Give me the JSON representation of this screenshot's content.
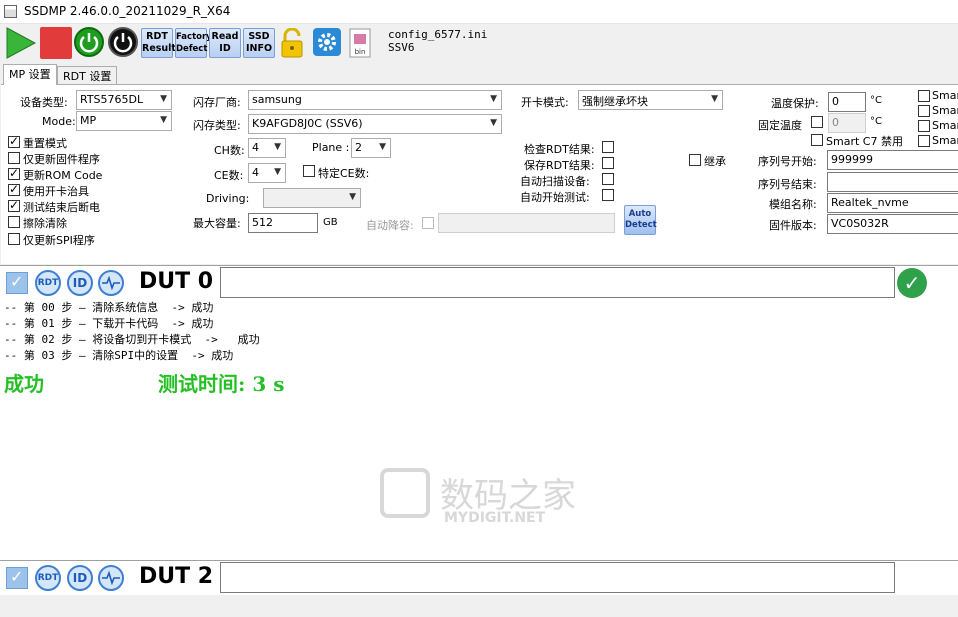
{
  "window": {
    "title": "SSDMP 2.46.0.0_20211029_R_X64"
  },
  "toolbar": {
    "rdt_result": [
      "RDT",
      "Result"
    ],
    "factory_defect": [
      "Factory",
      "Defect"
    ],
    "read_id": [
      "Read",
      "ID"
    ],
    "ssd_info": [
      "SSD",
      "INFO"
    ],
    "bin_label": "bin",
    "config_file": "config_6577.ini",
    "config_name": "SSV6"
  },
  "tabs": [
    "MP 设置",
    "RDT 设置"
  ],
  "mp": {
    "device_type_label": "设备类型:",
    "device_type": "RTS5765DL",
    "mode_label": "Mode:",
    "mode": "MP",
    "options": [
      {
        "label": "重置模式",
        "checked": true
      },
      {
        "label": "仅更新固件程序",
        "checked": false
      },
      {
        "label": "更新ROM Code",
        "checked": true
      },
      {
        "label": "使用开卡治具",
        "checked": true
      },
      {
        "label": "测试结束后断电",
        "checked": true
      },
      {
        "label": "擦除清除",
        "checked": false
      },
      {
        "label": "仅更新SPI程序",
        "checked": false
      }
    ],
    "flash_vendor_label": "闪存厂商:",
    "flash_vendor": "samsung",
    "flash_type_label": "闪存类型:",
    "flash_type": "K9AFGD8J0C (SSV6)",
    "ch_label": "CH数:",
    "ch": "4",
    "plane_label": "Plane :",
    "plane": "2",
    "ce_label": "CE数:",
    "ce": "4",
    "specific_ce_label": "特定CE数:",
    "driving_label": "Driving:",
    "driving": "",
    "max_capacity_label": "最大容量:",
    "max_capacity": "512",
    "gb_unit": "GB",
    "auto_downgrade_label": "自动降容:",
    "card_mode_label": "开卡模式:",
    "card_mode": "强制继承坏块",
    "check_rdt_label": "检查RDT结果:",
    "save_rdt_label": "保存RDT结果:",
    "auto_scan_label": "自动扫描设备:",
    "auto_start_label": "自动开始测试:",
    "inherit_label": "继承",
    "auto_detect": [
      "Auto",
      "Detect"
    ],
    "temp_protect_label": "温度保护:",
    "temp_protect": "0",
    "fixed_temp_label": "固定温度",
    "fixed_temp": "0",
    "temp_unit": "°C",
    "smart_c7_label": "Smart C7 禁用",
    "smart_labels": [
      "Smar",
      "Smar",
      "Smar",
      "Smar"
    ],
    "serial_start_label": "序列号开始:",
    "serial_start": "999999",
    "serial_end_label": "序列号结束:",
    "serial_end": "",
    "module_name_label": "模组名称:",
    "module_name": "Realtek_nvme",
    "firmware_label": "固件版本:",
    "firmware": "VC0S032R"
  },
  "dut0": {
    "title": "DUT 0",
    "rdt_icon": "RDT",
    "id_icon": "ID",
    "log": [
      "-- 第 00 步 — 清除系统信息  -> 成功",
      "-- 第 01 步 — 下载开卡代码  -> 成功",
      "-- 第 02 步 — 将设备切到开卡模式  ->   成功",
      "-- 第 03 步 — 清除SPI中的设置  -> 成功"
    ],
    "result": "成功",
    "test_time": "测试时间: 3 s"
  },
  "dut2": {
    "title": "DUT 2",
    "rdt_icon": "RDT",
    "id_icon": "ID"
  },
  "watermark": {
    "text": "数码之家",
    "url": "MYDIGIT.NET"
  }
}
